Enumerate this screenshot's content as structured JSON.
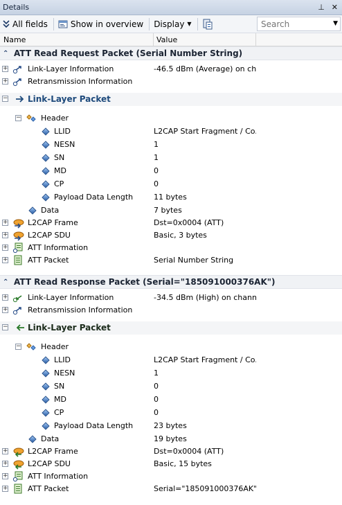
{
  "panel": {
    "title": "Details",
    "pin_glyph": "⊥",
    "close_glyph": "✕"
  },
  "toolbar": {
    "all_fields": "All fields",
    "show_in_overview": "Show in overview",
    "display": "Display",
    "search_placeholder": "Search"
  },
  "columns": {
    "name": "Name",
    "value": "Value"
  },
  "packets": [
    {
      "title": "ATT Read Request Packet (Serial Number String)",
      "link_layer_info": {
        "label": "Link-Layer Information",
        "value": "-46.5 dBm (Average) on ch..."
      },
      "retransmission": {
        "label": "Retransmission Information"
      },
      "ll_packet": "Link-Layer Packet",
      "header": "Header",
      "fields": [
        {
          "label": "LLID",
          "value": "L2CAP Start Fragment / Co..."
        },
        {
          "label": "NESN",
          "value": "1"
        },
        {
          "label": "SN",
          "value": "1"
        },
        {
          "label": "MD",
          "value": "0"
        },
        {
          "label": "CP",
          "value": "0"
        },
        {
          "label": "Payload Data Length",
          "value": "11 bytes"
        }
      ],
      "data": {
        "label": "Data",
        "value": "7 bytes"
      },
      "l2cap_frame": {
        "label": "L2CAP Frame",
        "value": "Dst=0x0004 (ATT)"
      },
      "l2cap_sdu": {
        "label": "L2CAP SDU",
        "value": "Basic, 3 bytes"
      },
      "att_info": {
        "label": "ATT Information"
      },
      "att_packet": {
        "label": "ATT Packet",
        "value": "Serial Number String"
      }
    },
    {
      "title": "ATT Read Response Packet (Serial=\"185091000376AK\")",
      "link_layer_info": {
        "label": "Link-Layer Information",
        "value": "-34.5 dBm (High) on chann..."
      },
      "retransmission": {
        "label": "Retransmission Information"
      },
      "ll_packet": "Link-Layer Packet",
      "header": "Header",
      "fields": [
        {
          "label": "LLID",
          "value": "L2CAP Start Fragment / Co..."
        },
        {
          "label": "NESN",
          "value": "1"
        },
        {
          "label": "SN",
          "value": "0"
        },
        {
          "label": "MD",
          "value": "0"
        },
        {
          "label": "CP",
          "value": "0"
        },
        {
          "label": "Payload Data Length",
          "value": "23 bytes"
        }
      ],
      "data": {
        "label": "Data",
        "value": "19 bytes"
      },
      "l2cap_frame": {
        "label": "L2CAP Frame",
        "value": "Dst=0x0004 (ATT)"
      },
      "l2cap_sdu": {
        "label": "L2CAP SDU",
        "value": "Basic, 15 bytes"
      },
      "att_info": {
        "label": "ATT Information"
      },
      "att_packet": {
        "label": "ATT Packet",
        "value": "Serial=\"185091000376AK\""
      }
    }
  ]
}
